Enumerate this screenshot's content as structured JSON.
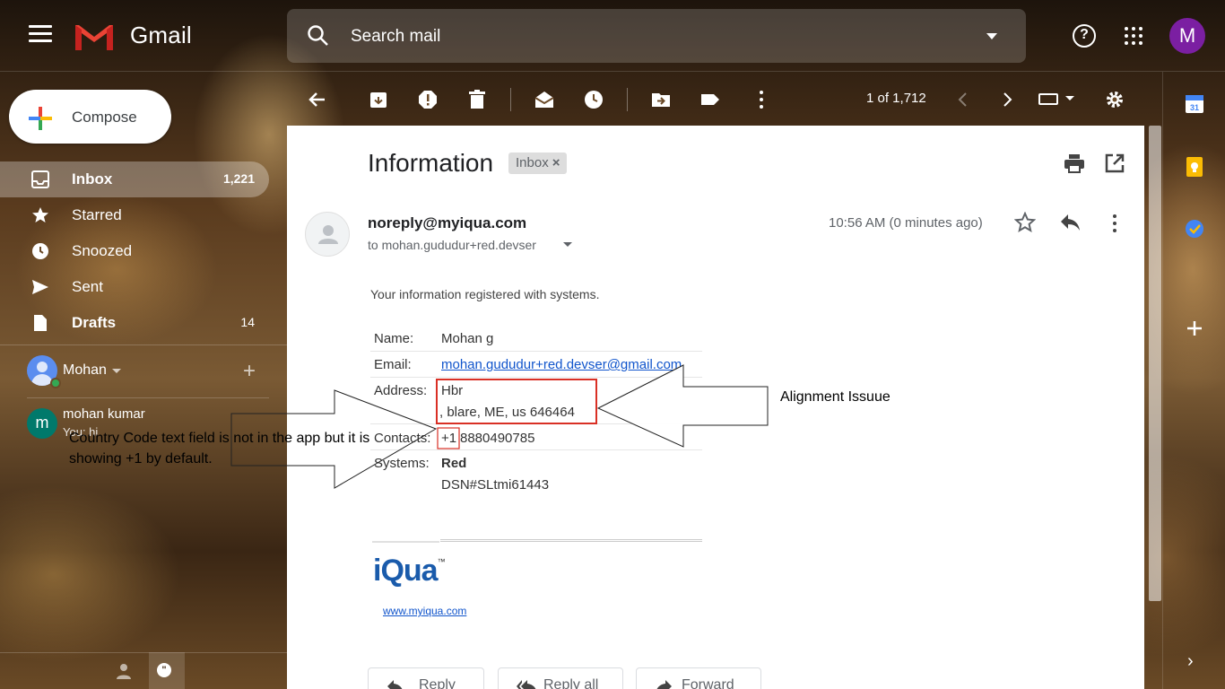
{
  "app": {
    "name": "Gmail"
  },
  "search": {
    "placeholder": "Search mail"
  },
  "account": {
    "avatar_letter": "M"
  },
  "compose": {
    "label": "Compose"
  },
  "sidebar": {
    "items": [
      {
        "label": "Inbox",
        "count": "1,221"
      },
      {
        "label": "Starred",
        "count": ""
      },
      {
        "label": "Snoozed",
        "count": ""
      },
      {
        "label": "Sent",
        "count": ""
      },
      {
        "label": "Drafts",
        "count": "14"
      }
    ]
  },
  "hangouts": {
    "user": "Mohan",
    "chats": [
      {
        "avatar_letter": "m",
        "name": "mohan kumar",
        "preview": "You: hi"
      }
    ]
  },
  "toolbar": {
    "pager": "1 of 1,712"
  },
  "email": {
    "subject": "Information",
    "label_chip": "Inbox",
    "label_remove": "×",
    "sender": "noreply@myiqua.com",
    "to": "to mohan.gududur+red.devser",
    "time": "10:56 AM (0 minutes ago)",
    "intro": "Your information registered with systems.",
    "fields": {
      "name_key": "Name:",
      "name_val": "Mohan g",
      "email_key": "Email:",
      "email_val": "mohan.gududur+red.devser@gmail.com",
      "address_key": "Address:",
      "address_line1": "Hbr",
      "address_line2": ", blare, ME, us 646464",
      "contacts_key": "Contacts:",
      "contacts_code": "+1",
      "contacts_number": "8880490785",
      "systems_key": "Systems:",
      "systems_val1": "Red",
      "systems_val2": "DSN#SLtmi61443"
    },
    "signature": {
      "logo_text": "iQua",
      "logo_mark": "™",
      "link": "www.myiqua.com"
    },
    "actions": {
      "reply": "Reply",
      "reply_all": "Reply all",
      "forward": "Forward"
    }
  },
  "annotations": {
    "alignment": "Alignment Issuue",
    "country_code": "Country Code text field is not in the app but it is showing +1 by default."
  },
  "colors": {
    "accent_red": "#d93025",
    "link": "#1155cc",
    "avatar": "#7b1fa2"
  }
}
